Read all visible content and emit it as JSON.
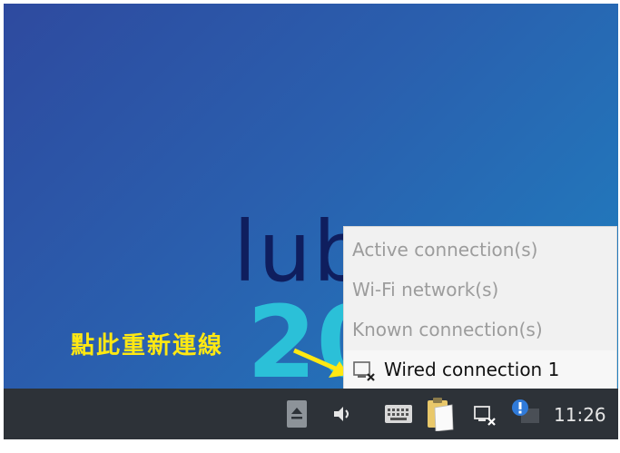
{
  "desktop": {
    "brand_text": "lub",
    "year_text": "20"
  },
  "annotation": {
    "text": "點此重新連線"
  },
  "network_menu": {
    "items": [
      {
        "label": "Active connection(s)",
        "enabled": false
      },
      {
        "label": "Wi-Fi network(s)",
        "enabled": false
      },
      {
        "label": "Known connection(s)",
        "enabled": false
      },
      {
        "label": "Wired connection 1",
        "enabled": true
      }
    ]
  },
  "taskbar": {
    "icons": [
      "eject-icon",
      "volume-icon",
      "keyboard-icon",
      "clipboard-icon",
      "network-disconnected-icon",
      "notification-icon"
    ],
    "clock": "11:26"
  },
  "colors": {
    "annotation": "#ffe812",
    "taskbar": "#2d3238",
    "menu_bg": "#f1f1f1"
  }
}
